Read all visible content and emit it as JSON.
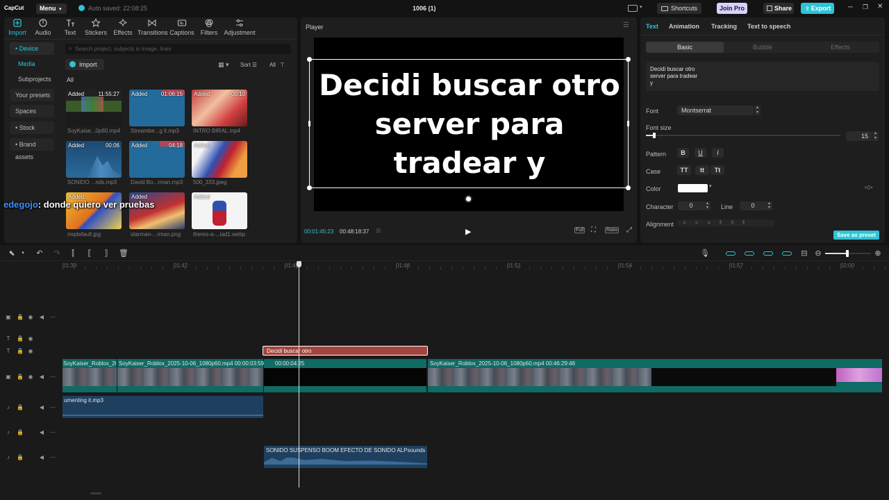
{
  "app": {
    "logo": "CapCut",
    "menu_label": "Menu",
    "autosave": "Auto saved: 22:08:25",
    "project_title": "1006 (1)",
    "shortcuts_label": "Shortcuts",
    "joinpro_label": "Join Pro",
    "share_label": "Share",
    "export_label": "Export"
  },
  "toolbar": {
    "items": [
      {
        "label": "Import",
        "icon": "import-icon"
      },
      {
        "label": "Audio",
        "icon": "audio-icon"
      },
      {
        "label": "Text",
        "icon": "text-icon"
      },
      {
        "label": "Stickers",
        "icon": "stickers-icon"
      },
      {
        "label": "Effects",
        "icon": "effects-icon"
      },
      {
        "label": "Transitions",
        "icon": "transitions-icon"
      },
      {
        "label": "Captions",
        "icon": "captions-icon"
      },
      {
        "label": "Filters",
        "icon": "filters-icon"
      },
      {
        "label": "Adjustment",
        "icon": "adjustment-icon"
      }
    ]
  },
  "sidebar": {
    "items": [
      {
        "label": "• Device"
      },
      {
        "label": "Media"
      },
      {
        "label": "Subprojects"
      },
      {
        "label": "Your presets"
      },
      {
        "label": "Spaces"
      },
      {
        "label": "• Stock mate..."
      },
      {
        "label": "• Brand assets"
      }
    ]
  },
  "media": {
    "search_placeholder": "Search project, subjects in image, lines",
    "import_label": "Import",
    "sort_label": "Sort",
    "all_filter": "All",
    "all_heading": "All",
    "items": [
      {
        "added": "Added",
        "duration": "11:55:27",
        "name": "SoyKaise...0p60.mp4"
      },
      {
        "added": "Added",
        "duration": "01:06:15",
        "name": "Streambe...g it.mp3"
      },
      {
        "added": "Added",
        "duration": "00:10",
        "name": "INTRO BIRAL.mp4"
      },
      {
        "added": "Added",
        "duration": "00:06",
        "name": "SONIDO ...nds.mp3"
      },
      {
        "added": "Added",
        "duration": "04:18",
        "name": "David Bo...rman.mp3"
      },
      {
        "added": "Added",
        "duration": "",
        "name": "500_333.jpeg"
      },
      {
        "added": "Added",
        "duration": "",
        "name": "mqdefault.jpg"
      },
      {
        "added": "Added",
        "duration": "",
        "name": "starman-...rman.png"
      },
      {
        "added": "Added",
        "duration": "",
        "name": "theres-a-...iad1.webp"
      }
    ]
  },
  "overlay_caption": {
    "user": "edegojo",
    "message": ": donde quiero ver pruebas"
  },
  "player": {
    "title": "Player",
    "caption_text": "Decidi buscar otro server para tradear y",
    "current_time": "00:01:45:23",
    "total_time": "00:48:18:37",
    "full_label": "Full",
    "ratio_label": "Ratio"
  },
  "properties": {
    "tabs": [
      "Text",
      "Animation",
      "Tracking",
      "Text to speech"
    ],
    "subtabs": [
      "Basic",
      "Bubble",
      "Effects"
    ],
    "text_content": "Decidi buscar otro\nserver para tradear\ny",
    "font_label": "Font",
    "font_value": "Montserrat",
    "fontsize_label": "Font size",
    "fontsize_value": "15",
    "pattern_label": "Pattern",
    "pattern_buttons": [
      "B",
      "U",
      "I"
    ],
    "case_label": "Case",
    "case_buttons": [
      "TT",
      "tt",
      "Tt"
    ],
    "color_label": "Color",
    "color_value": "#ffffff",
    "character_label": "Character",
    "character_value": "0",
    "line_label": "Line",
    "line_value": "0",
    "alignment_label": "Alignment",
    "save_preset_label": "Save as preset"
  },
  "timeline": {
    "ruler": [
      "01:39",
      "01:42",
      "01:45",
      "01:48",
      "01:51",
      "01:54",
      "01:57",
      "02:00"
    ],
    "text_clip": "Decidi buscar otro",
    "video_clips": [
      {
        "label": "SoyKaiser_Roblox_202"
      },
      {
        "label": "SoyKaiser_Roblox_2025-10-06_1080p60.mp4   00:00:03:59"
      },
      {
        "label": "00:00:04:25"
      },
      {
        "label": "SoyKaiser_Roblox_2025-10-06_1080p60.mp4   00:46:29:46"
      }
    ],
    "audio_clip_1": "umenting it.mp3",
    "audio_clip_2": "SONIDO SUSPENSO BOOM  EFECTO DE SONIDO  ALPsounds -- BC"
  },
  "colors": {
    "accent": "#2ec4d6",
    "text_clip": "#a3453f",
    "video_clip": "#0f6b63",
    "audio_clip": "#1f3f5f",
    "export": "#2ec4d6"
  }
}
